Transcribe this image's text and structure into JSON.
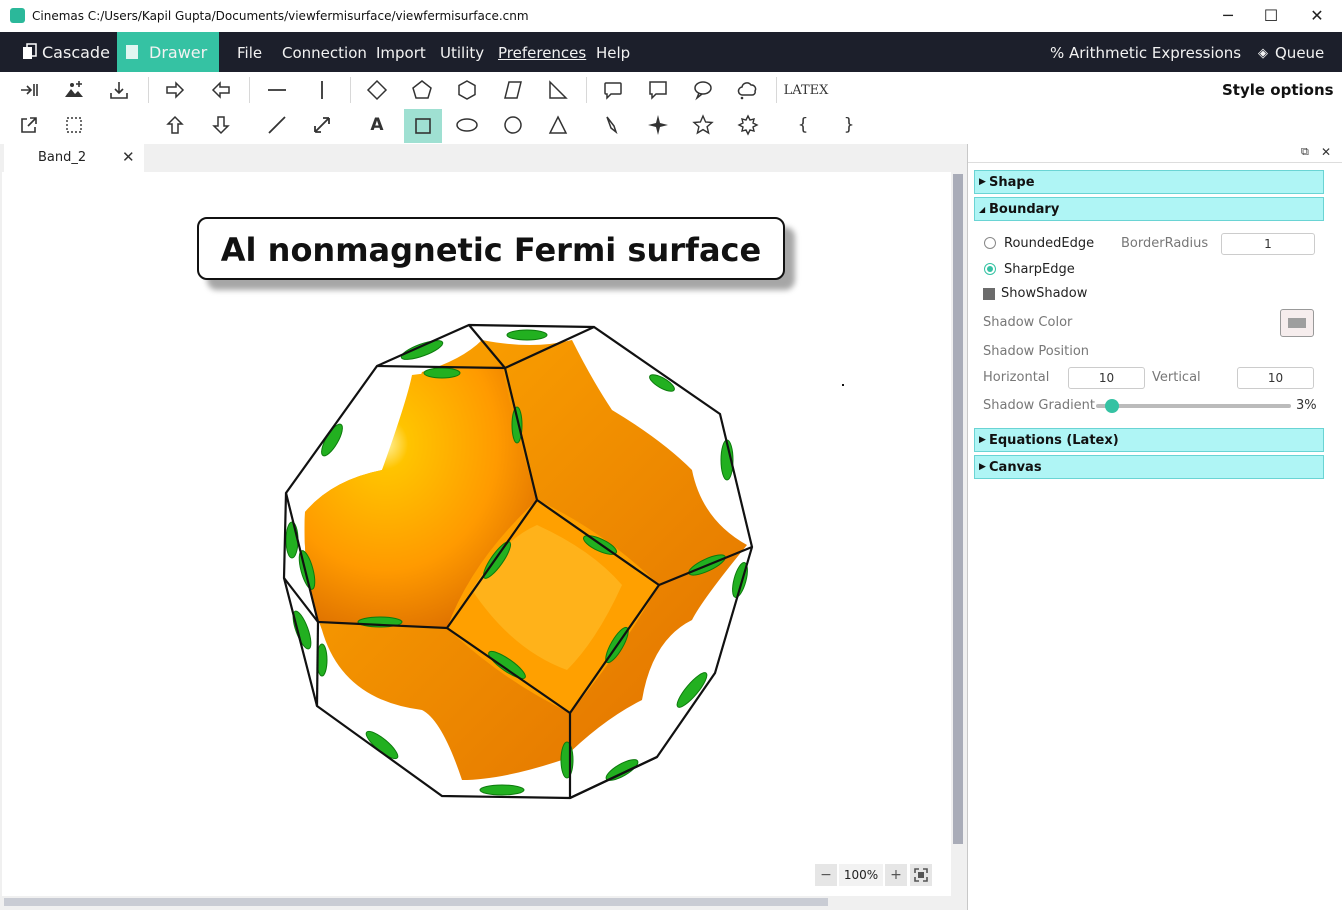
{
  "window": {
    "title": "Cinemas C:/Users/Kapil Gupta/Documents/viewfermisurface/viewfermisurface.cnm",
    "minimize": "─",
    "maximize": "☐",
    "close": "✕"
  },
  "menubar": {
    "cascade": "Cascade",
    "drawer": "Drawer",
    "items": [
      "File",
      "Connection",
      "Import",
      "Utility",
      "Preferences",
      "Help"
    ],
    "arithmetic": "Arithmetic Expressions",
    "queue": "Queue"
  },
  "toolbar": {
    "latex_label": "LATEX",
    "style_options": "Style options",
    "text_tool": "A",
    "brace_open": "{",
    "brace_close": "}"
  },
  "tab": {
    "label": "Band_2",
    "close": "✕"
  },
  "canvas": {
    "title_text": "Al nonmagnetic Fermi surface"
  },
  "zoom": {
    "minus": "−",
    "level": "100%",
    "plus": "+"
  },
  "panel": {
    "sections": {
      "shape": "Shape",
      "boundary": "Boundary",
      "equations": "Equations (Latex)",
      "canvas": "Canvas"
    },
    "boundary": {
      "rounded_edge": "RoundedEdge",
      "border_radius_label": "BorderRadius",
      "border_radius_value": "1",
      "sharp_edge": "SharpEdge",
      "show_shadow": "ShowShadow",
      "shadow_color_label": "Shadow Color",
      "shadow_color": "#9e9e9e",
      "shadow_position_label": "Shadow Position",
      "horizontal_label": "Horizontal",
      "horizontal_value": "10",
      "vertical_label": "Vertical",
      "vertical_value": "10",
      "gradient_label": "Shadow Gradient",
      "gradient_value": "3%",
      "gradient_fraction": 0.03,
      "selected_edge": "SharpEdge"
    }
  },
  "colors": {
    "menubar_bg": "#1c1f2b",
    "accent": "#35c2a3",
    "section_bg": "#aff5f5",
    "fermi_orange": "#ff8c00",
    "fermi_green": "#22b020"
  }
}
